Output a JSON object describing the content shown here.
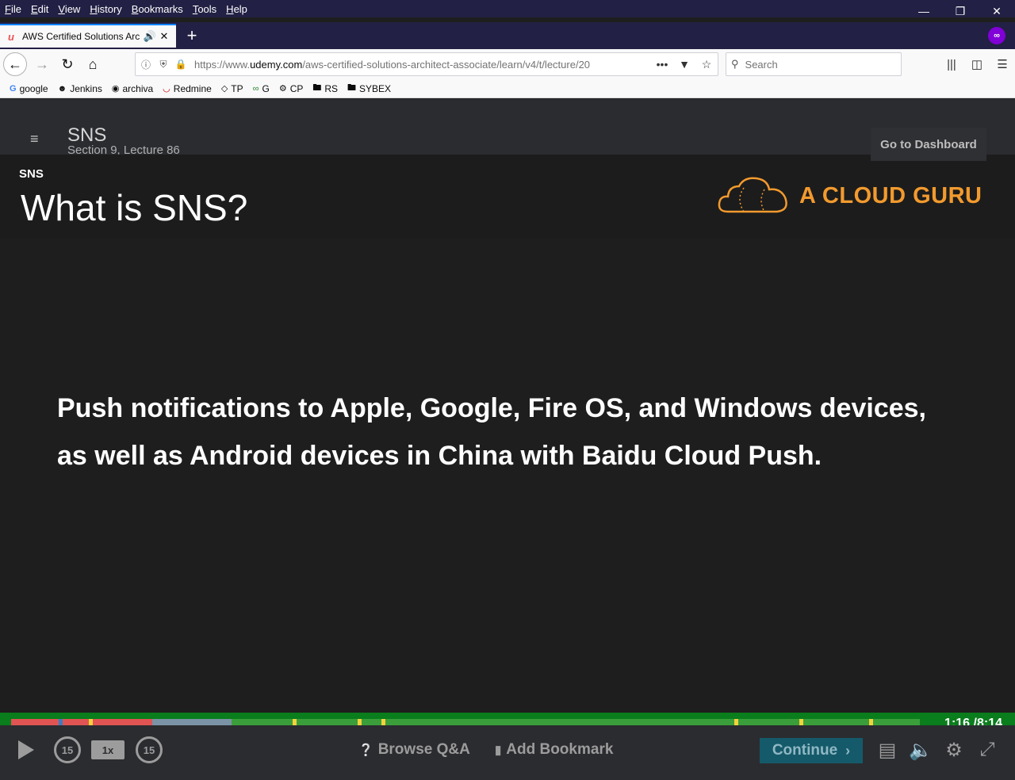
{
  "browser": {
    "menu": [
      "File",
      "Edit",
      "View",
      "History",
      "Bookmarks",
      "Tools",
      "Help"
    ],
    "tab": {
      "title": "AWS Certified Solutions Architect",
      "favicon": "udemy-icon"
    },
    "url": {
      "scheme_host": "https://www.",
      "domain": "udemy.com",
      "path": "/aws-certified-solutions-architect-associate/learn/v4/t/lecture/20"
    },
    "search_placeholder": "Search",
    "bookmarks": [
      {
        "label": "google",
        "icon": "google-icon"
      },
      {
        "label": "Jenkins",
        "icon": "jenkins-icon"
      },
      {
        "label": "archiva",
        "icon": "archiva-icon"
      },
      {
        "label": "Redmine",
        "icon": "redmine-icon"
      },
      {
        "label": "TP",
        "icon": "tp-icon"
      },
      {
        "label": "G",
        "icon": "g-icon"
      },
      {
        "label": "CP",
        "icon": "cp-icon"
      },
      {
        "label": "RS",
        "icon": "folder-icon"
      },
      {
        "label": "SYBEX",
        "icon": "folder-icon"
      }
    ]
  },
  "course": {
    "title": "SNS",
    "subtitle": "Section 9, Lecture 86",
    "dashboard_label": "Go to Dashboard"
  },
  "video": {
    "tag": "SNS",
    "title": "What is SNS?",
    "brand": "A CLOUD GURU",
    "slide_text": "Push notifications to Apple, Google, Fire OS, and Windows devices, as well as Android devices in China with Baidu Cloud Push.",
    "time_current": "1:16",
    "time_total": "/8:14",
    "progress_fraction": 0.155,
    "colors": {
      "accent_orange": "#f29a2e",
      "progress_green": "#3a9f3a",
      "progress_red": "#e05454",
      "continue_bg": "#155a6a"
    }
  },
  "controls": {
    "skip_back_label": "15",
    "speed_label": "1x",
    "skip_forward_label": "15",
    "browse_qa_label": "Browse Q&A",
    "add_bookmark_label": "Add Bookmark",
    "continue_label": "Continue"
  }
}
